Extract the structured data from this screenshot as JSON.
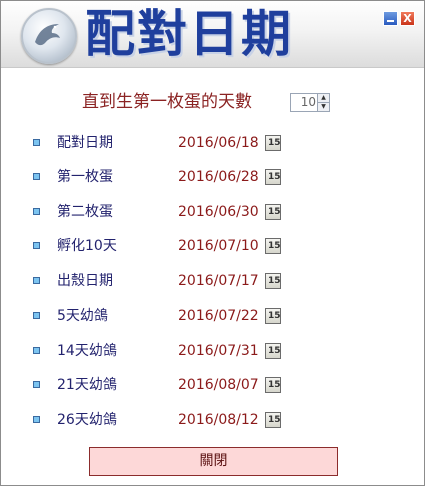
{
  "header": {
    "app_title": "配對日期",
    "close_glyph": "X",
    "logo_icon": "pigeon-logo-icon"
  },
  "hatch": {
    "label": "直到生第一枚蛋的天數",
    "days_value": "10"
  },
  "schedule": [
    {
      "label": "配對日期",
      "date": "2016/06/18"
    },
    {
      "label": "第一枚蛋",
      "date": "2016/06/28"
    },
    {
      "label": "第二枚蛋",
      "date": "2016/06/30"
    },
    {
      "label": "孵化10天",
      "date": "2016/07/10"
    },
    {
      "label": "出殼日期",
      "date": "2016/07/17"
    },
    {
      "label": "5天幼鴿",
      "date": "2016/07/22"
    },
    {
      "label": "14天幼鴿",
      "date": "2016/07/31"
    },
    {
      "label": "21天幼鴿",
      "date": "2016/08/07"
    },
    {
      "label": "26天幼鴿",
      "date": "2016/08/12"
    }
  ],
  "calendar_glyph": "15",
  "footer": {
    "close_label": "關閉"
  },
  "colors": {
    "title_blue": "#1f3f9d",
    "label_navy": "#23236e",
    "date_red": "#8b1a1a",
    "close_bg": "#fdd8d8"
  }
}
